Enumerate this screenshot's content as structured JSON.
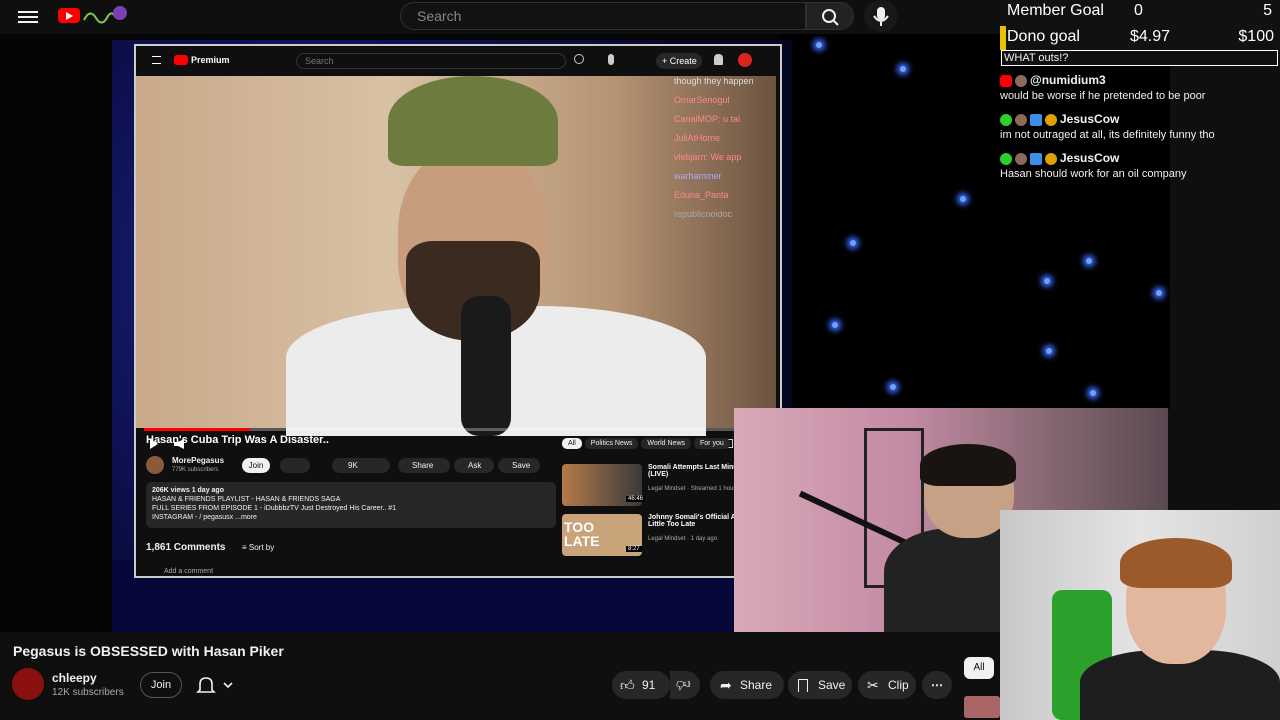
{
  "header": {
    "search_placeholder": "Search"
  },
  "goals": {
    "member_label": "Member Goal",
    "member_current": "0",
    "member_target": "5",
    "dono_label": "Dono goal",
    "dono_current": "$4.97",
    "dono_target": "$100",
    "message": "WHAT outs!?"
  },
  "chat": [
    {
      "user": "@numidium3",
      "text": "would be worse if he pretended to be poor"
    },
    {
      "user": "JesusCow",
      "text": "im not outraged at all, its definitely funny tho"
    },
    {
      "user": "JesusCow",
      "text": "Hasan should work for an oil company"
    }
  ],
  "embed": {
    "search_placeholder": "Search",
    "create_label": "Create",
    "logo_label": "Premium",
    "overlay_chat": [
      "though they happen",
      "OmarSenogul",
      "CanalMOP: u tal",
      "JuliAtHome",
      "vlebjarn: We app",
      "warhammer",
      "Eduna_Panta",
      "republicnoidoc"
    ],
    "video_title": "Hasan's Cuba Trip Was A Disaster..",
    "channel": "MorePegasus",
    "subs": "779K subscribers",
    "join": "Join",
    "likes": "9K",
    "share": "Share",
    "ask": "Ask",
    "save": "Save",
    "desc_line1": "206K views 1 day ago",
    "desc_line2": "HASAN & FRIENDS PLAYLIST - HASAN & FRIENDS SAGA",
    "desc_line3": "FULL SERIES FROM EPISODE 1 - iDubbbzTV Just Destroyed His Career.. #1",
    "desc_line4": "INSTAGRAM - / pegasusx ...more",
    "comments": "1,861 Comments",
    "sort": "Sort by",
    "add_comment": "Add a comment",
    "chips": [
      "All",
      "Politics News",
      "World News",
      "For you"
    ],
    "rec1_title": "Somali Attempts Last Minute Apology (LIVE)",
    "rec1_meta": "Legal Mindset · Streamed 1 hour ago",
    "rec1_time": "46:46",
    "rec2_title": "Johnny Somali's Official Apology: Too Little Too Late",
    "rec2_meta": "Legal Mindset · 1 day ago",
    "rec2_time": "8:27",
    "rec2_badge": "TOO LATE",
    "progress": 0.17
  },
  "video": {
    "title": "Pegasus is OBSESSED with Hasan Piker",
    "channel": "chleepy",
    "subs": "12K subscribers",
    "join": "Join",
    "likes": "91",
    "share": "Share",
    "save": "Save",
    "clip": "Clip",
    "chip_all": "All"
  }
}
